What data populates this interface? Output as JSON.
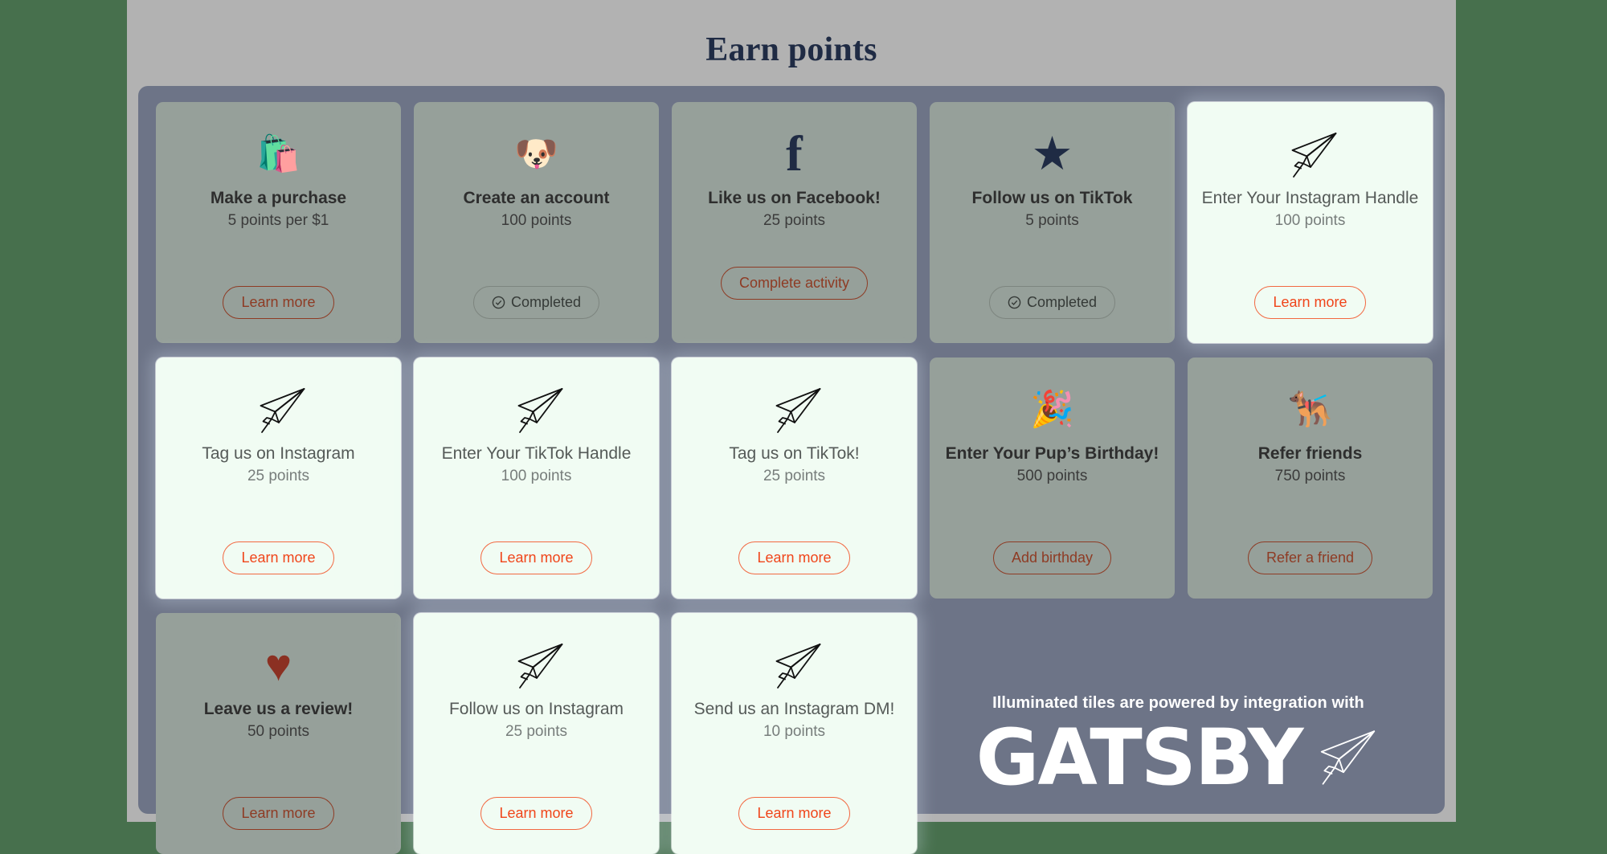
{
  "page": {
    "title": "Earn points",
    "background_color": "#47704d",
    "sheet_color": "#b2b2b2",
    "panel_color": "#6d7487",
    "tile_color": "#96a09a",
    "lit_tile_color": "#f1fcf3",
    "accent_color": "#8e3b24",
    "lit_accent_color": "#f0451a"
  },
  "tiles": [
    {
      "title": "Make a purchase",
      "points": "5 points per $1",
      "action": "Learn more",
      "icon": "shopping-bag-dog-icon",
      "glyph": "🛍️",
      "state": "normal"
    },
    {
      "title": "Create an account",
      "points": "100 points",
      "action": "Completed",
      "icon": "dog-face-icon",
      "glyph": "🐶",
      "state": "completed"
    },
    {
      "title": "Like us on Facebook!",
      "points": "25 points",
      "action": "Complete activity",
      "icon": "facebook-icon",
      "glyph": "f",
      "state": "normal"
    },
    {
      "title": "Follow us on TikTok",
      "points": "5 points",
      "action": "Completed",
      "icon": "star-icon",
      "glyph": "★",
      "state": "completed"
    },
    {
      "title": "Enter Your Instagram Handle",
      "points": "100 points",
      "action": "Learn more",
      "icon": "paper-plane-icon",
      "glyph": "",
      "state": "lit"
    },
    {
      "title": "Tag us on Instagram",
      "points": "25 points",
      "action": "Learn more",
      "icon": "paper-plane-icon",
      "glyph": "",
      "state": "lit"
    },
    {
      "title": "Enter Your TikTok Handle",
      "points": "100 points",
      "action": "Learn more",
      "icon": "paper-plane-icon",
      "glyph": "",
      "state": "lit"
    },
    {
      "title": "Tag us on TikTok!",
      "points": "25 points",
      "action": "Learn more",
      "icon": "paper-plane-icon",
      "glyph": "",
      "state": "lit"
    },
    {
      "title": "Enter Your Pup’s Birthday!",
      "points": "500 points",
      "action": "Add birthday",
      "icon": "party-hat-balloons-icon",
      "glyph": "🎉",
      "state": "normal"
    },
    {
      "title": "Refer friends",
      "points": "750 points",
      "action": "Refer a friend",
      "icon": "service-dog-icon",
      "glyph": "🐕‍🦺",
      "state": "normal"
    },
    {
      "title": "Leave us a review!",
      "points": "50 points",
      "action": "Learn more",
      "icon": "heart-icon",
      "glyph": "♥",
      "state": "normal"
    },
    {
      "title": "Follow us on Instagram",
      "points": "25 points",
      "action": "Learn more",
      "icon": "paper-plane-icon",
      "glyph": "",
      "state": "lit"
    },
    {
      "title": "Send us an Instagram DM!",
      "points": "10 points",
      "action": "Learn more",
      "icon": "paper-plane-icon",
      "glyph": "",
      "state": "lit"
    }
  ],
  "branding": {
    "caption": "Illuminated tiles are powered by integration with",
    "wordmark": "GATSBY",
    "logo_icon": "paper-plane-icon"
  }
}
